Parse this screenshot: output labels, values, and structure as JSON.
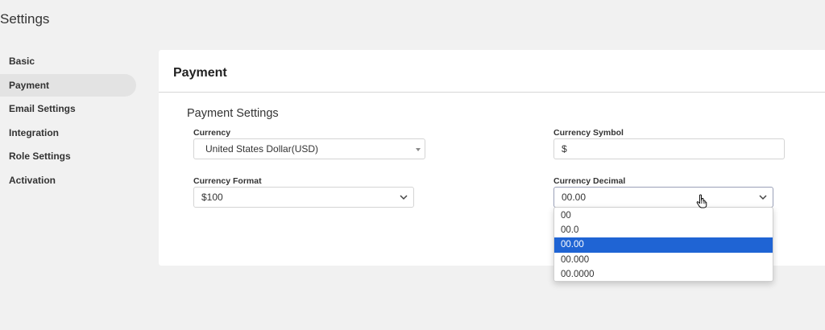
{
  "page": {
    "title": "Settings"
  },
  "sidebar": {
    "items": [
      {
        "label": "Basic",
        "active": false
      },
      {
        "label": "Payment",
        "active": true
      },
      {
        "label": "Email Settings",
        "active": false
      },
      {
        "label": "Integration",
        "active": false
      },
      {
        "label": "Role Settings",
        "active": false
      },
      {
        "label": "Activation",
        "active": false
      }
    ]
  },
  "card": {
    "title": "Payment",
    "section_title": "Payment Settings",
    "currency": {
      "label": "Currency",
      "value": "United States Dollar(USD)"
    },
    "currency_symbol": {
      "label": "Currency Symbol",
      "value": "$"
    },
    "currency_format": {
      "label": "Currency Format",
      "value": "$100"
    },
    "currency_decimal": {
      "label": "Currency Decimal",
      "value": "00.00",
      "options": [
        "00",
        "00.0",
        "00.00",
        "00.000",
        "00.0000"
      ],
      "selected_index": 2
    }
  },
  "colors": {
    "selected_option": "#1f64d4",
    "background": "#f1f1f1",
    "card": "#ffffff"
  },
  "icons": [
    "chevron-down-icon",
    "caret-down-icon",
    "hand-pointer-icon"
  ]
}
